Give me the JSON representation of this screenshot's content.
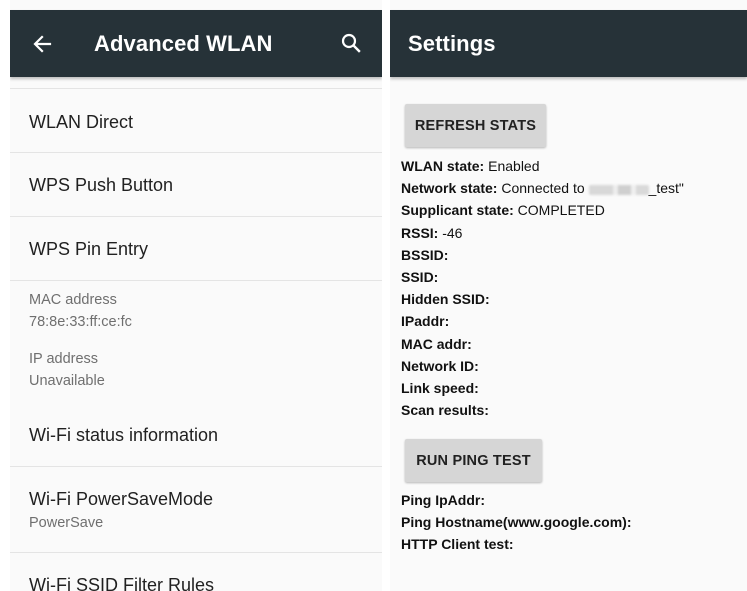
{
  "left": {
    "title": "Advanced WLAN",
    "items": [
      {
        "label": "WLAN Direct"
      },
      {
        "label": "WPS Push Button"
      },
      {
        "label": "WPS Pin Entry"
      }
    ],
    "mac": {
      "label": "MAC address",
      "value": "78:8e:33:ff:ce:fc"
    },
    "ip": {
      "label": "IP address",
      "value": "Unavailable"
    },
    "items2": [
      {
        "label": "Wi-Fi status information"
      },
      {
        "label": "Wi-Fi PowerSaveMode",
        "sub": "PowerSave"
      },
      {
        "label": "Wi-Fi SSID Filter Rules"
      }
    ]
  },
  "right": {
    "title": "Settings",
    "refresh_button": "REFRESH STATS",
    "ping_button": "RUN PING TEST",
    "stats": [
      {
        "key": "WLAN state:",
        "value": " Enabled"
      },
      {
        "key": "Network state:",
        "value": " Connected to ",
        "value_suffix": "_test\""
      },
      {
        "key": "Supplicant state:",
        "value": " COMPLETED"
      },
      {
        "key": "RSSI:",
        "value": " -46"
      },
      {
        "key": "BSSID:",
        "value": ""
      },
      {
        "key": "SSID:",
        "value": ""
      },
      {
        "key": "Hidden SSID:",
        "value": ""
      },
      {
        "key": "IPaddr:",
        "value": ""
      },
      {
        "key": "MAC addr:",
        "value": ""
      },
      {
        "key": "Network ID:",
        "value": ""
      },
      {
        "key": "Link speed:",
        "value": ""
      },
      {
        "key": "Scan results:",
        "value": ""
      }
    ],
    "ping": [
      {
        "key": "Ping IpAddr:"
      },
      {
        "key": "Ping Hostname(www.google.com):"
      },
      {
        "key": "HTTP Client test:"
      }
    ]
  },
  "icons": {
    "back": "arrow-back-icon",
    "search": "search-icon"
  },
  "colors": {
    "appbar": "#263238",
    "button": "#d6d6d6",
    "background": "#fafafa"
  }
}
